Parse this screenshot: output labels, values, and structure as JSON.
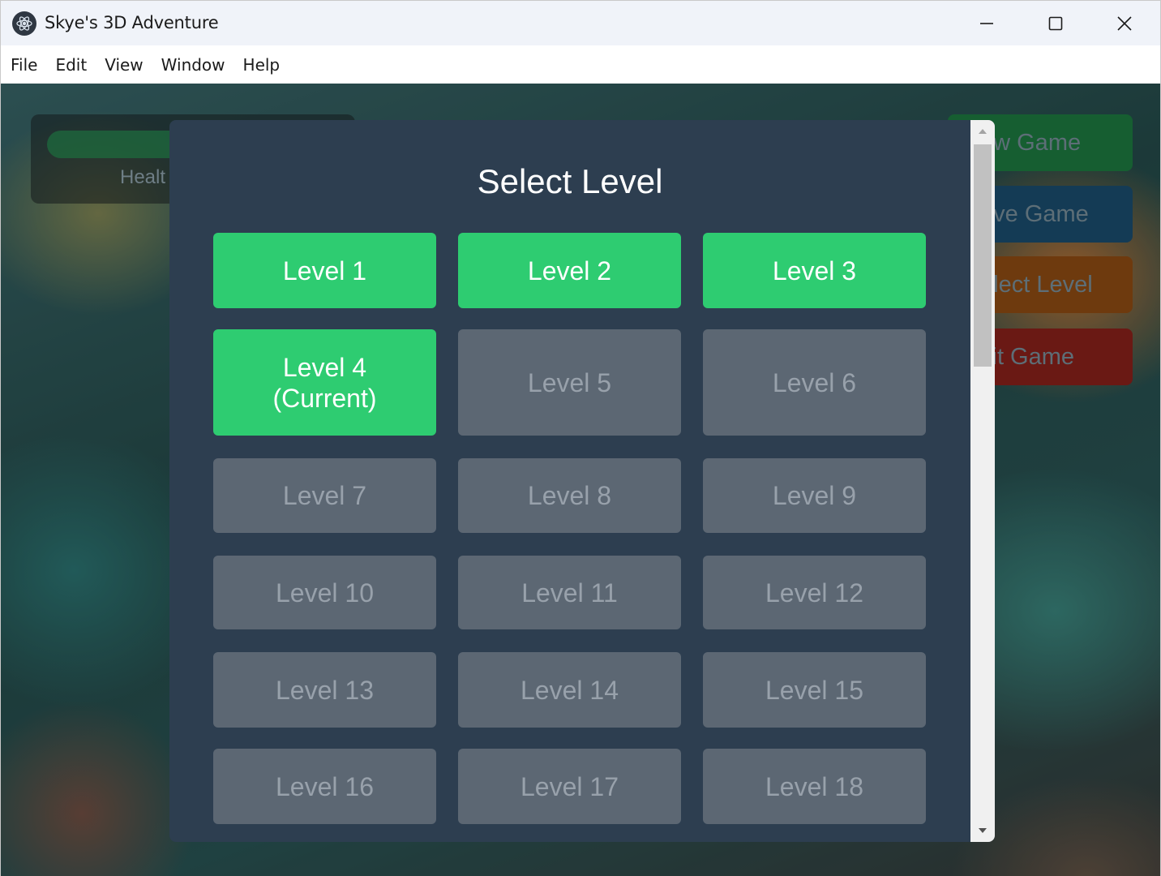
{
  "window": {
    "title": "Skye's 3D Adventure",
    "controls": {
      "minimize": "minimize-icon",
      "maximize": "maximize-icon",
      "close": "close-icon"
    }
  },
  "menubar": {
    "items": [
      {
        "label": "File"
      },
      {
        "label": "Edit"
      },
      {
        "label": "View"
      },
      {
        "label": "Window"
      },
      {
        "label": "Help"
      }
    ]
  },
  "hud": {
    "health_label": "Healt",
    "side_buttons": {
      "new_game": "ew Game",
      "save_game": "ave Game",
      "select_level": "elect Level",
      "exit_game": "xit Game"
    }
  },
  "modal": {
    "title": "Select Level",
    "levels": [
      {
        "label": "Level 1",
        "state": "unlocked"
      },
      {
        "label": "Level 2",
        "state": "unlocked"
      },
      {
        "label": "Level 3",
        "state": "unlocked"
      },
      {
        "label": "Level 4",
        "sublabel": "(Current)",
        "state": "current"
      },
      {
        "label": "Level 5",
        "state": "locked"
      },
      {
        "label": "Level 6",
        "state": "locked"
      },
      {
        "label": "Level 7",
        "state": "locked"
      },
      {
        "label": "Level 8",
        "state": "locked"
      },
      {
        "label": "Level 9",
        "state": "locked"
      },
      {
        "label": "Level 10",
        "state": "locked"
      },
      {
        "label": "Level 11",
        "state": "locked"
      },
      {
        "label": "Level 12",
        "state": "locked"
      },
      {
        "label": "Level 13",
        "state": "locked"
      },
      {
        "label": "Level 14",
        "state": "locked"
      },
      {
        "label": "Level 15",
        "state": "locked"
      },
      {
        "label": "Level 16",
        "state": "locked"
      },
      {
        "label": "Level 17",
        "state": "locked"
      },
      {
        "label": "Level 18",
        "state": "locked"
      }
    ]
  },
  "colors": {
    "unlocked": "#2ecc71",
    "locked": "#5c6773",
    "modal_bg": "#2d3e50"
  }
}
